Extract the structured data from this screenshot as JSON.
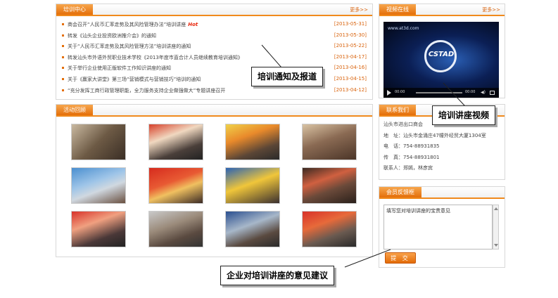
{
  "training": {
    "title": "培训中心",
    "more": "更多>>",
    "items": [
      {
        "title": "商会召开“人民币汇率走势及其风险管理办法”培训讲座",
        "date": "[2013-05-31]",
        "hot": "Hot"
      },
      {
        "title": "转发《汕头企业投资欧洲推介会》的通知",
        "date": "[2013-05-30]"
      },
      {
        "title": "关于“人民币汇率走势及其风险管理方法”培训讲座的通知",
        "date": "[2013-05-22]"
      },
      {
        "title": "转发汕头市外语外贸职业技术学校《2013年度市直合计人员继续教育培训通知》",
        "date": "[2013-04-17]"
      },
      {
        "title": "关于举行企业使用正版软件工作知识讲座的通知",
        "date": "[2013-04-16]"
      },
      {
        "title": "关于《赢家大讲堂》第三场“营销模式与营销技巧”培训的通知",
        "date": "[2013-04-15]"
      },
      {
        "title": "“充分发挥工商行政管理职能，全力服务支持企业做强做大”专题讲座召开",
        "date": "[2013-04-12]"
      }
    ]
  },
  "activity": {
    "title": "活动回顾"
  },
  "video": {
    "title": "视频在线",
    "more": "更多>>",
    "url_text": "www.at3d.com",
    "logo_text": "CSTAD",
    "time_left": "00:00",
    "time_right": "00:00"
  },
  "contact": {
    "title": "联系我们",
    "lines": [
      "汕头市进出口商会",
      "地　址：汕头市金涌庄47幢外经贸大厦1304室",
      "电　话：754-88931835",
      "传　真：754-88931801",
      "联系人：郑嫣，林彦宾"
    ]
  },
  "feedback": {
    "title": "会员反馈框",
    "text": "填写您对培训讲座的宝贵意见",
    "submit": "提 交"
  },
  "callouts": {
    "training": "培训通知及报道",
    "video": "培训讲座视频",
    "feedback": "企业对培训讲座的意见建议"
  },
  "colors": {
    "accent": "#e46f0a",
    "date": "#d9620b",
    "hot": "#e8260c"
  },
  "icons": [
    "play-icon",
    "volume-icon",
    "fullscreen-icon",
    "scroll-up-icon",
    "scroll-down-icon"
  ]
}
